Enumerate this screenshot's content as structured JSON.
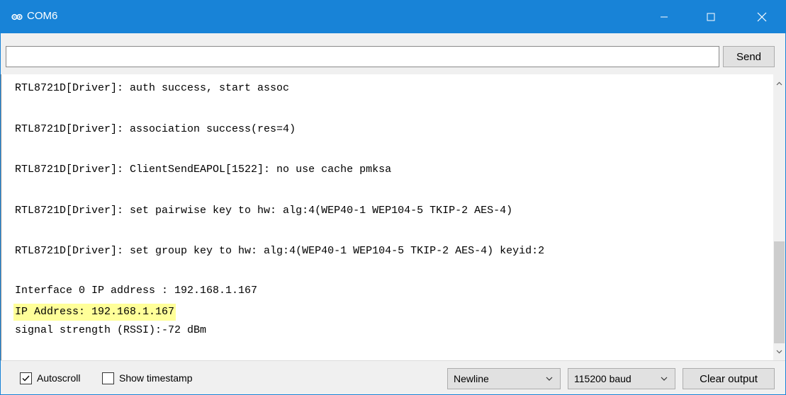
{
  "window": {
    "title": "COM6",
    "accent_color": "#1883d7",
    "icon": "arduino-icon"
  },
  "send_bar": {
    "input_value": "",
    "input_placeholder": "",
    "send_label": "Send"
  },
  "output": {
    "lines": [
      "RTL8721D[Driver]: auth success, start assoc",
      "RTL8721D[Driver]: association success(res=4)",
      "RTL8721D[Driver]: ClientSendEAPOL[1522]: no use cache pmksa",
      "RTL8721D[Driver]: set pairwise key to hw: alg:4(WEP40-1 WEP104-5 TKIP-2 AES-4)",
      "RTL8721D[Driver]: set group key to hw: alg:4(WEP40-1 WEP104-5 TKIP-2 AES-4) keyid:2",
      "Interface 0 IP address : 192.168.1.167",
      "IP Address: 192.168.1.167",
      "signal strength (RSSI):-72 dBm"
    ],
    "highlight_color": "#ffff99"
  },
  "bottom_bar": {
    "autoscroll_label": "Autoscroll",
    "autoscroll_checked": true,
    "timestamp_label": "Show timestamp",
    "timestamp_checked": false,
    "line_ending": "Newline",
    "baud_rate": "115200 baud",
    "clear_label": "Clear output"
  }
}
